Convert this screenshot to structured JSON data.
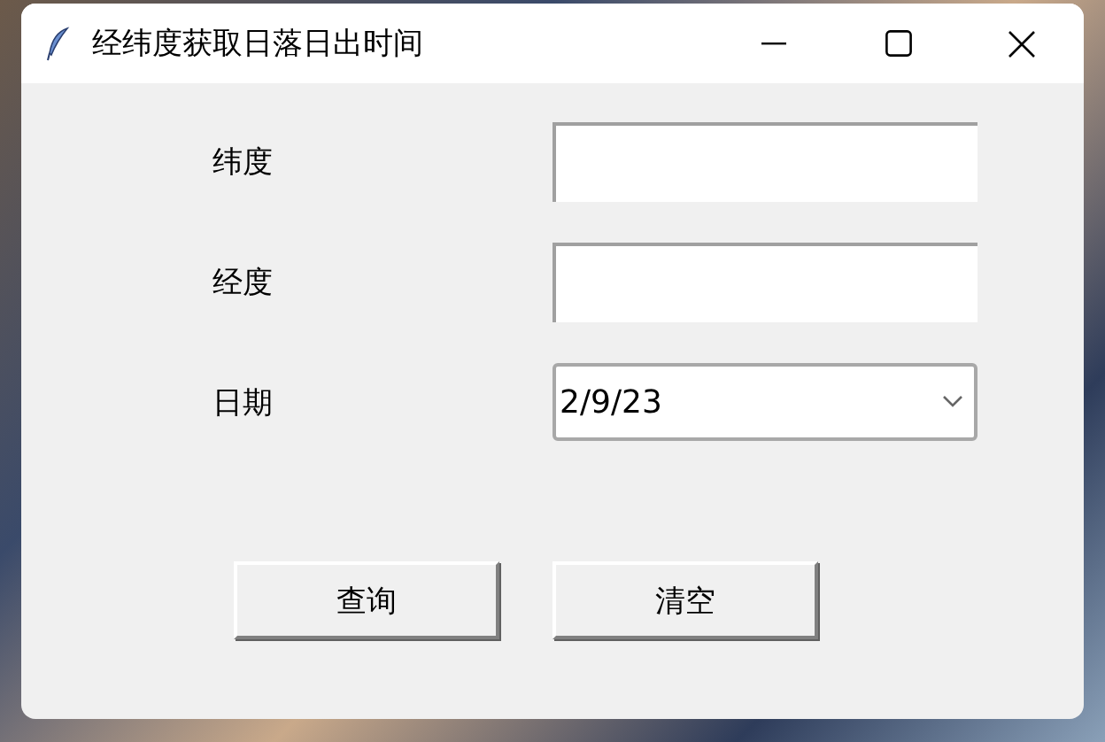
{
  "window": {
    "title": "经纬度获取日落日出时间"
  },
  "fields": [
    {
      "label": "纬度",
      "kind": "entry"
    },
    {
      "label": "经度",
      "kind": "entry"
    },
    {
      "label": "日期",
      "kind": "combo",
      "value": "2/9/23"
    }
  ],
  "buttons": [
    "查询",
    "清空"
  ]
}
